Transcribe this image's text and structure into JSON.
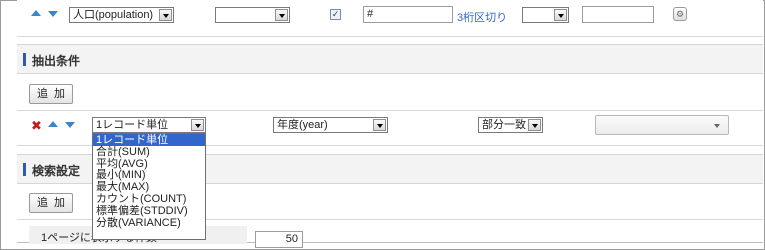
{
  "top_row": {
    "population_select": "人口(population)",
    "empty_select_1": "",
    "checkbox_checked": true,
    "format_value": "#",
    "format_hint": "3桁区切り",
    "empty_select_2": "",
    "empty_input": ""
  },
  "section_extract": {
    "title": "抽出条件"
  },
  "add_button_label": "追加",
  "condition_row": {
    "aggregate_select": "1レコード単位",
    "field_select": "年度(year)",
    "match_select": "部分一致",
    "value_select": ""
  },
  "aggregate_options": [
    "1レコード単位",
    "合計(SUM)",
    "平均(AVG)",
    "最小(MIN)",
    "最大(MAX)",
    "カウント(COUNT)",
    "標準偏差(STDDIV)",
    "分散(VARIANCE)"
  ],
  "section_search": {
    "title": "検索設定"
  },
  "rows_per_page": {
    "label": "1ページに表示する件数",
    "value": "50"
  },
  "colors": {
    "accent": "#2f5aa8",
    "highlight": "#3366cc",
    "delete": "#cc1a1a"
  }
}
